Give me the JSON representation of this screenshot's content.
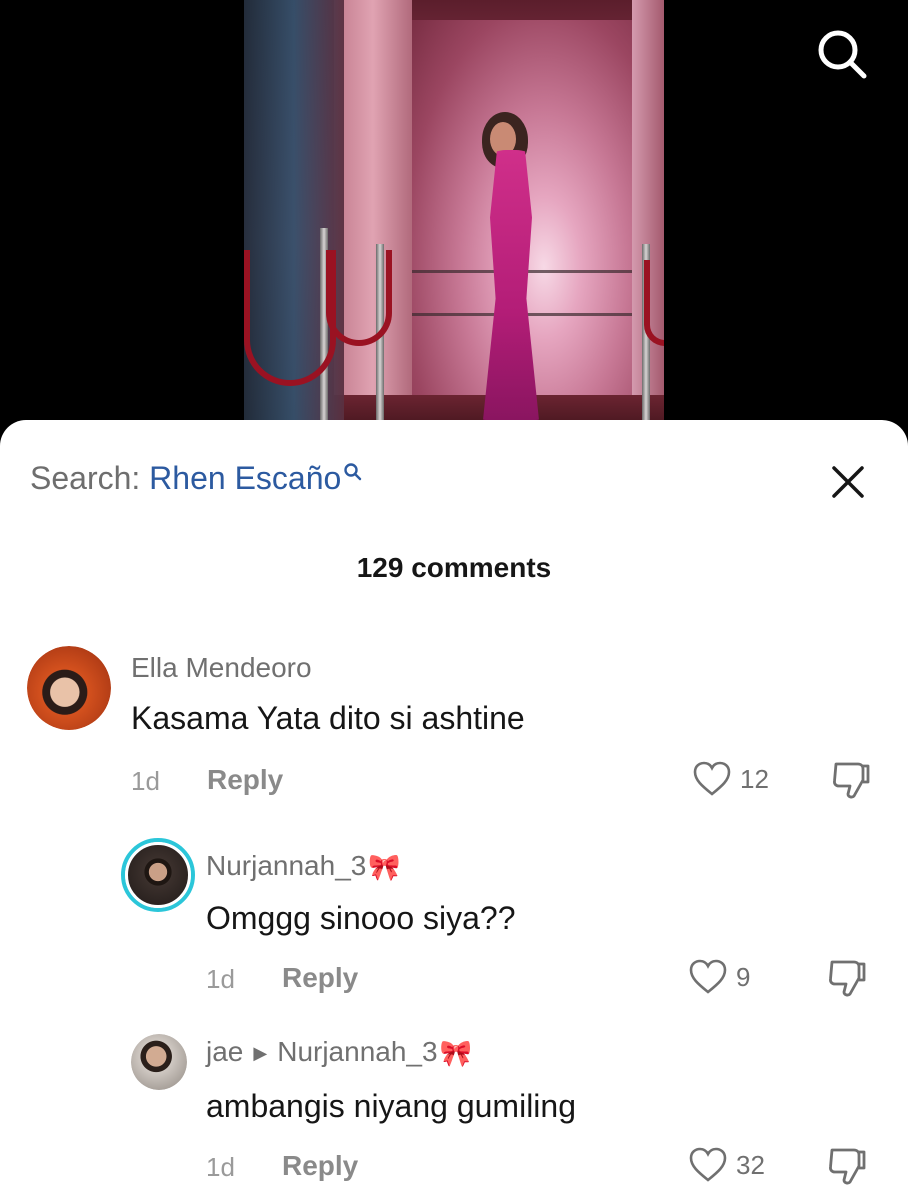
{
  "search_bar": {
    "prefix": "Search:",
    "term": "Rhen Escaño"
  },
  "comment_count": "129 comments",
  "comments": [
    {
      "user": "Ella Mendeoro",
      "text": "Kasama Yata dito si ashtine",
      "time": "1d",
      "reply_label": "Reply",
      "likes": "12"
    },
    {
      "user": "Nurjannah_3",
      "text": "Omggg sinooo siya??",
      "time": "1d",
      "reply_label": "Reply",
      "likes": "9"
    },
    {
      "user": "jae",
      "reply_to": "Nurjannah_3",
      "text": "ambangis niyang gumiling",
      "time": "1d",
      "reply_label": "Reply",
      "likes": "32"
    }
  ],
  "icons": {
    "top_search": "search-icon",
    "close": "close-icon",
    "like": "heart-icon",
    "dislike": "thumbs-down-icon",
    "bow": "ribbon-emoji"
  },
  "colors": {
    "search_term": "#2c5aa0",
    "sheet_bg": "#ffffff",
    "story_ring": "#2bc6d9"
  }
}
